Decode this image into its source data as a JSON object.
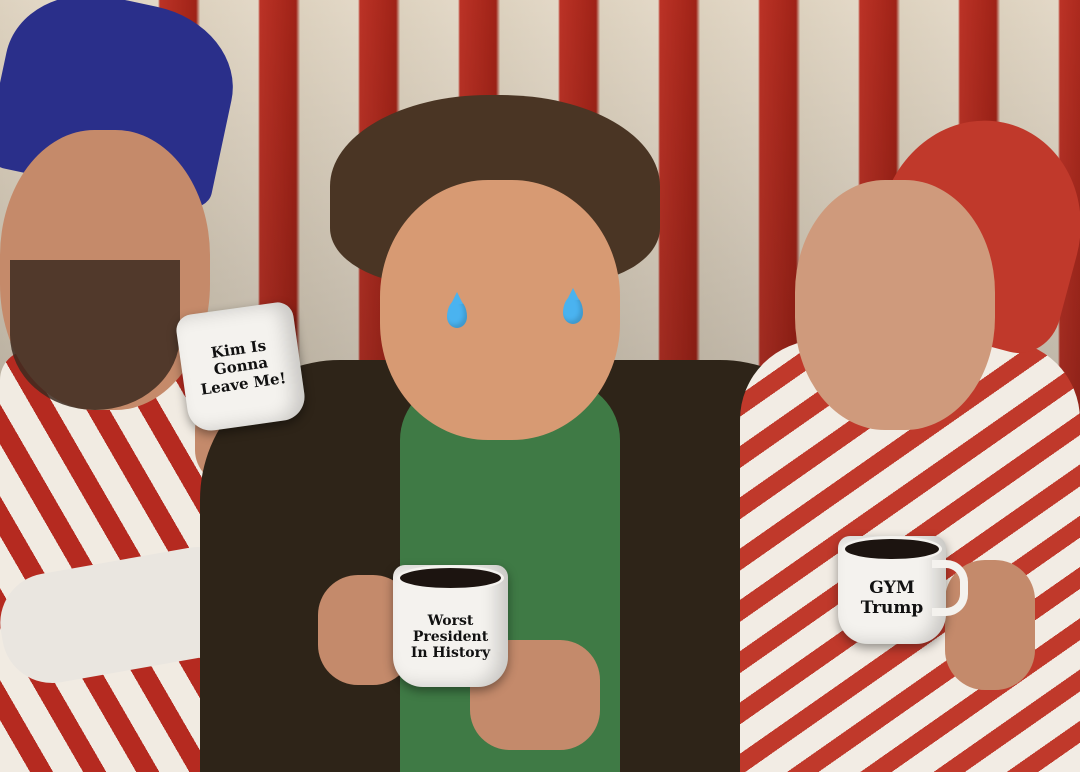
{
  "scene": {
    "description_colors": {
      "curtain_red": "#b52a20",
      "curtain_cream": "#ece1cf",
      "tear_blue": "#4ab3f0"
    }
  },
  "mugs": {
    "left": {
      "lines": [
        "Kim Is",
        "Gonna",
        "Leave Me!"
      ]
    },
    "middle": {
      "lines": [
        "Worst",
        "President",
        "In History"
      ]
    },
    "right": {
      "lines": [
        "GYM",
        "Trump"
      ]
    }
  },
  "icons": {
    "tear": "crying-tear-emoji"
  }
}
